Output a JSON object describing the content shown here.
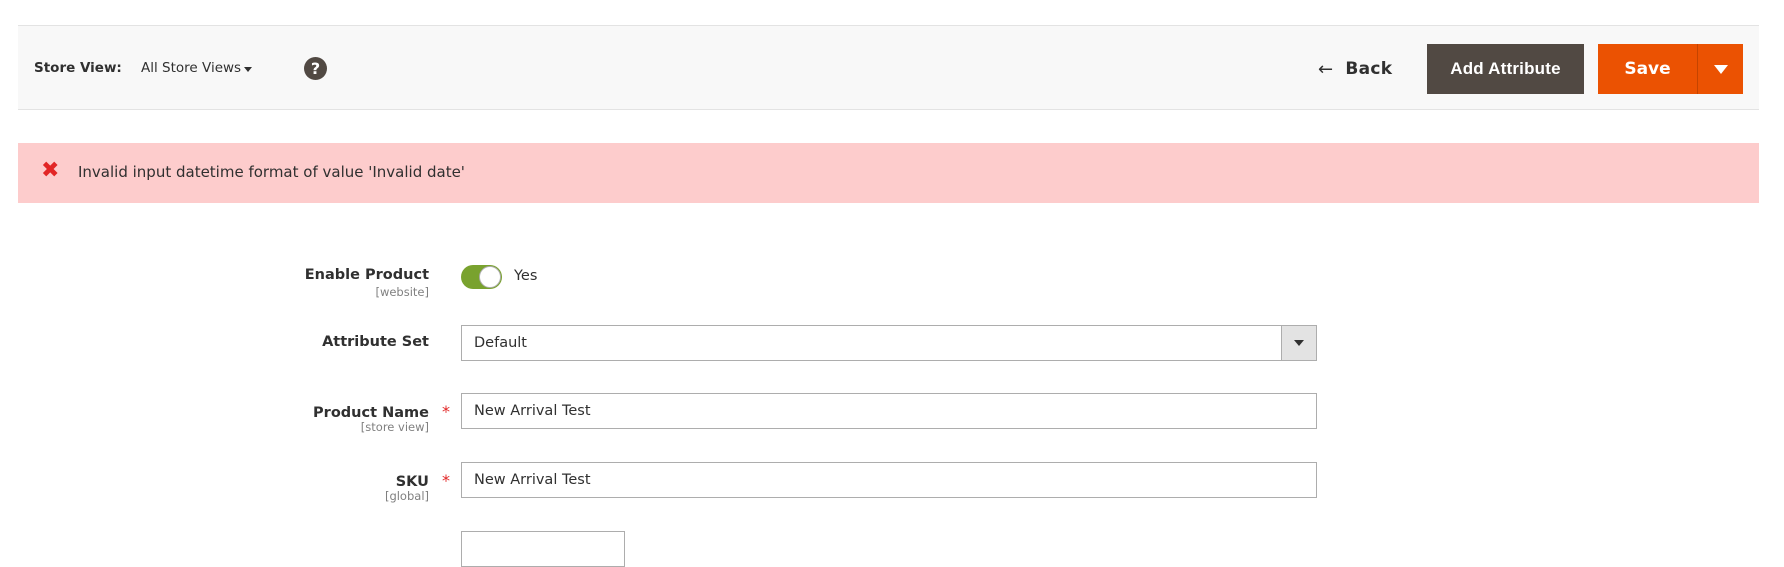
{
  "toolbar": {
    "store_view_label": "Store View:",
    "store_view_value": "All Store Views",
    "help_icon_glyph": "?",
    "back_arrow_glyph": "←",
    "back_label": "Back",
    "add_attribute_label": "Add Attribute",
    "save_label": "Save"
  },
  "message": {
    "type": "error",
    "icon_glyph": "✖",
    "text": "Invalid input datetime format of value 'Invalid date'"
  },
  "form": {
    "enable_product": {
      "label": "Enable Product",
      "scope": "[website]",
      "value_label": "Yes",
      "enabled": true
    },
    "attribute_set": {
      "label": "Attribute Set",
      "value": "Default"
    },
    "product_name": {
      "label": "Product Name",
      "scope": "[store view]",
      "required_mark": "*",
      "value": "New Arrival Test"
    },
    "sku": {
      "label": "SKU",
      "scope": "[global]",
      "required_mark": "*",
      "value": "New Arrival Test"
    }
  },
  "colors": {
    "primary": "#eb5202",
    "secondary": "#514943",
    "toggle_on": "#79a22e",
    "error_bg": "#fdcccc",
    "error_icon": "#e22626"
  }
}
